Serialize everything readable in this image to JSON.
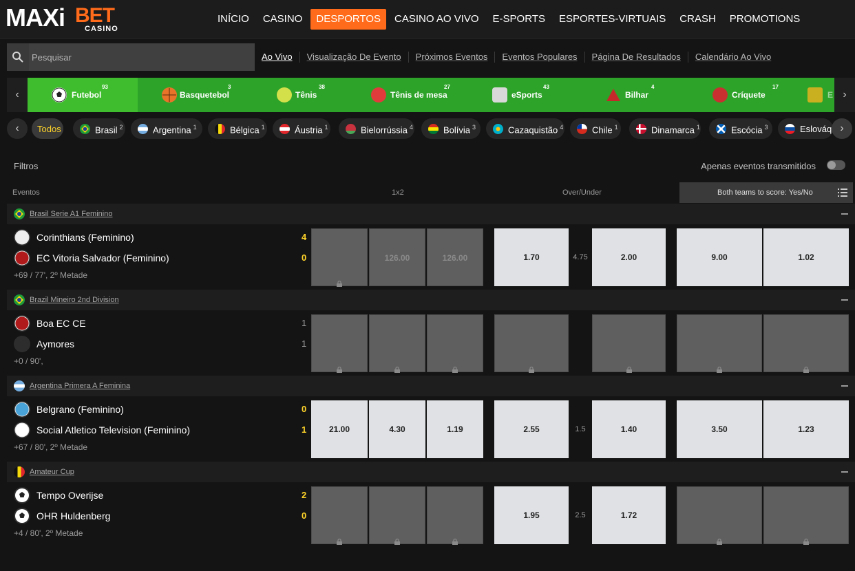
{
  "brand": {
    "maxi": "MAXi",
    "bet": "BET",
    "casino": "CASINO",
    "accent": "#ff6b1a"
  },
  "nav": [
    "INÍCIO",
    "CASINO",
    "DESPORTOS",
    "CASINO AO VIVO",
    "E-SPORTS",
    "ESPORTES-VIRTUAIS",
    "CRASH",
    "PROMOTIONS"
  ],
  "nav_active": "DESPORTOS",
  "search": {
    "placeholder": "Pesquisar"
  },
  "subnav": [
    "Ao Vivo",
    "Visualização De Evento",
    "Próximos Eventos",
    "Eventos Populares",
    "Página De Resultados",
    "Calendário Ao Vivo"
  ],
  "sports": [
    {
      "name": "Futebol",
      "count": "93",
      "icon": "soccer-ball-icon"
    },
    {
      "name": "Basquetebol",
      "count": "3",
      "icon": "basketball-icon"
    },
    {
      "name": "Tênis",
      "count": "38",
      "icon": "tennis-ball-icon"
    },
    {
      "name": "Tênis de mesa",
      "count": "27",
      "icon": "table-tennis-icon"
    },
    {
      "name": "eSports",
      "count": "43",
      "icon": "gamepad-icon"
    },
    {
      "name": "Bilhar",
      "count": "4",
      "icon": "billiards-icon"
    },
    {
      "name": "Críquete",
      "count": "17",
      "icon": "cricket-ball-icon"
    },
    {
      "name": "E",
      "count": "",
      "icon": "shield-icon"
    }
  ],
  "countries": [
    {
      "name": "Todos",
      "count": ""
    },
    {
      "name": "Brasil",
      "count": "2"
    },
    {
      "name": "Argentina",
      "count": "1"
    },
    {
      "name": "Bélgica",
      "count": "1"
    },
    {
      "name": "Áustria",
      "count": "1"
    },
    {
      "name": "Bielorrússia",
      "count": "4"
    },
    {
      "name": "Bolívia",
      "count": "3"
    },
    {
      "name": "Cazaquistão",
      "count": "4"
    },
    {
      "name": "Chile",
      "count": "1"
    },
    {
      "name": "Dinamarca",
      "count": "1"
    },
    {
      "name": "Escócia",
      "count": "3"
    },
    {
      "name": "Eslováq",
      "count": ""
    }
  ],
  "filters": {
    "label": "Filtros",
    "stream_only": "Apenas eventos transmitidos"
  },
  "columns": {
    "events": "Eventos",
    "onex2": "1x2",
    "over_under": "Over/Under",
    "btts": "Both teams to score: Yes/No"
  },
  "leagues": [
    {
      "name": "Brasil Serie A1 Feminino",
      "home": "Corinthians (Feminino)",
      "away": "EC Vitoria Salvador (Feminino)",
      "home_score": "4",
      "away_score": "0",
      "time": "+69 / 77', 2º Metade",
      "odds": [
        "",
        "126.00",
        "126.00",
        "1.70",
        "2.00",
        "9.00",
        "1.02"
      ],
      "handicap": "4.75",
      "locked": [
        true,
        true,
        true,
        false,
        false,
        false,
        false
      ]
    },
    {
      "name": "Brazil Mineiro 2nd Division",
      "home": "Boa EC CE",
      "away": "Aymores",
      "home_score": "1",
      "away_score": "1",
      "time": "+0 / 90',",
      "odds": [
        "",
        "",
        "",
        "",
        "",
        "",
        ""
      ],
      "handicap": "",
      "locked": [
        true,
        true,
        true,
        true,
        true,
        true,
        true
      ]
    },
    {
      "name": "Argentina Primera A Feminina",
      "home": "Belgrano (Feminino)",
      "away": "Social Atletico Television (Feminino)",
      "home_score": "0",
      "away_score": "1",
      "time": "+67 / 80', 2º Metade",
      "odds": [
        "21.00",
        "4.30",
        "1.19",
        "2.55",
        "1.40",
        "3.50",
        "1.23"
      ],
      "handicap": "1.5",
      "locked": [
        false,
        false,
        false,
        false,
        false,
        false,
        false
      ]
    },
    {
      "name": "Amateur Cup",
      "home": "Tempo Overijse",
      "away": "OHR Huldenberg",
      "home_score": "2",
      "away_score": "0",
      "time": "+4 / 80', 2º Metade",
      "odds": [
        "",
        "",
        "",
        "1.95",
        "1.72",
        "",
        ""
      ],
      "handicap": "2.5",
      "locked": [
        true,
        true,
        true,
        false,
        false,
        true,
        true
      ]
    }
  ]
}
